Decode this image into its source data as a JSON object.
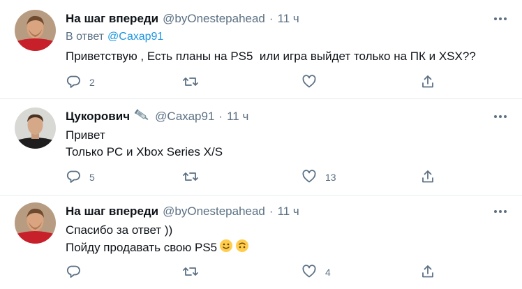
{
  "tweets": [
    {
      "name": "На шаг впереди",
      "handle": "@byOnestepahead",
      "separator": "·",
      "time": "11 ч",
      "reply_prefix": "В ответ",
      "reply_to": "@Сахар91",
      "lines": [
        "Приветствую , Есть планы на PS5  или игра выйдет только на ПК и XSX??"
      ],
      "reply_count": "2",
      "retweet_count": "",
      "like_count": ""
    },
    {
      "name": "Цукорович",
      "handle": "@Сахар91",
      "separator": "·",
      "time": "11 ч",
      "badge_icon": "syringe-icon",
      "lines": [
        "Привет",
        "Только PC и Xbox Series X/S"
      ],
      "reply_count": "5",
      "retweet_count": "",
      "like_count": "13"
    },
    {
      "name": "На шаг впереди",
      "handle": "@byOnestepahead",
      "separator": "·",
      "time": "11 ч",
      "lines": [
        "Спасибо за ответ ))",
        "Пойду продавать свою PS5"
      ],
      "emojis": [
        "slightly-smiling-face",
        "upside-down-face"
      ],
      "reply_count": "",
      "retweet_count": "",
      "like_count": "4"
    }
  ],
  "colors": {
    "text": "#0f1419",
    "secondary": "#5b7083",
    "link": "#1b95e0",
    "divider": "#e6ecf0",
    "background": "#ffffff"
  },
  "icons": {
    "reply": "reply-icon",
    "retweet": "retweet-icon",
    "like": "heart-icon",
    "share": "share-icon",
    "more": "more-icon"
  }
}
